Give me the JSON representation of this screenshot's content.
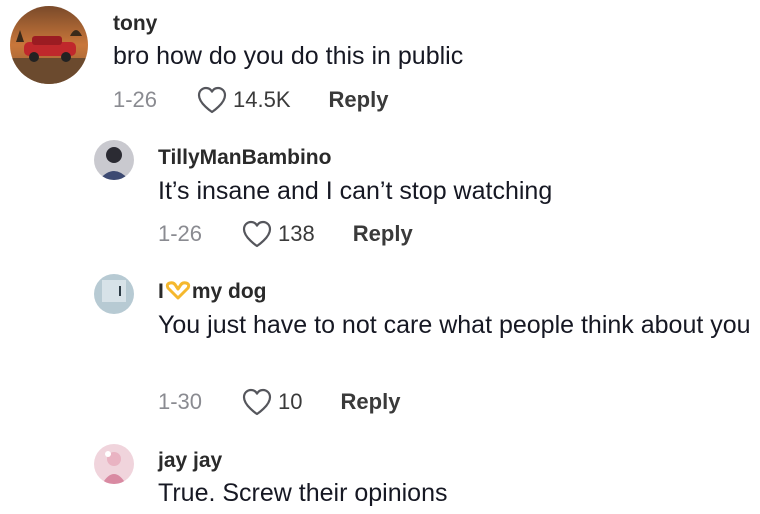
{
  "comments": [
    {
      "username": "tony",
      "text": "bro how do you do this in public",
      "date": "1-26",
      "likes": "14.5K",
      "reply_label": "Reply",
      "avatar_icon": "sunset-car-avatar"
    },
    {
      "username": "TillyManBambino",
      "text": "It’s insane and I can’t stop watching",
      "date": "1-26",
      "likes": "138",
      "reply_label": "Reply",
      "avatar_icon": "person-avatar"
    },
    {
      "username_prefix": "I",
      "username_emoji": "heart-hands-emoji",
      "username_suffix": "my dog",
      "text": "You just have to not care what people think about you",
      "date": "1-30",
      "likes": "10",
      "reply_label": "Reply",
      "avatar_icon": "pale-blue-avatar"
    },
    {
      "username": "jay jay",
      "text": "True. Screw their opinions",
      "avatar_icon": "pink-figure-avatar"
    }
  ],
  "colors": {
    "text_primary": "#161823",
    "text_secondary": "#8a8b91",
    "heart_emoji": "#f5b82e"
  }
}
